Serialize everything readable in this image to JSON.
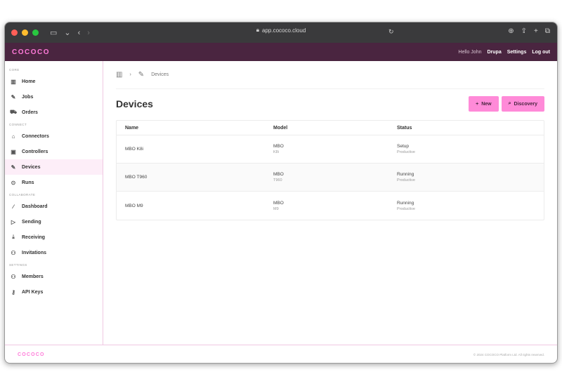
{
  "browser": {
    "url": "app.cococo.cloud"
  },
  "topbar": {
    "brand": "COCOCO",
    "greeting": "Hello John",
    "links": [
      "Drupa",
      "Settings",
      "Log out"
    ]
  },
  "sidebar": {
    "sections": [
      {
        "label": "CORE",
        "items": [
          {
            "label": "Home",
            "icon": "building-icon"
          },
          {
            "label": "Jobs",
            "icon": "wrench-icon"
          },
          {
            "label": "Orders",
            "icon": "cart-icon"
          }
        ]
      },
      {
        "label": "CONNECT",
        "items": [
          {
            "label": "Connectors",
            "icon": "plug-icon"
          },
          {
            "label": "Controllers",
            "icon": "chip-icon"
          },
          {
            "label": "Devices",
            "icon": "tool-icon",
            "active": true
          },
          {
            "label": "Runs",
            "icon": "play-icon"
          }
        ]
      },
      {
        "label": "COLLABORATE",
        "items": [
          {
            "label": "Dashboard",
            "icon": "pencil-icon"
          },
          {
            "label": "Sending",
            "icon": "send-icon"
          },
          {
            "label": "Receiving",
            "icon": "download-icon"
          },
          {
            "label": "Invitations",
            "icon": "users-icon"
          }
        ]
      },
      {
        "label": "SETTINGS",
        "items": [
          {
            "label": "Members",
            "icon": "users-icon"
          },
          {
            "label": "API Keys",
            "icon": "key-icon"
          }
        ]
      }
    ]
  },
  "breadcrumb": {
    "current": "Devices"
  },
  "page": {
    "title": "Devices",
    "new_label": "New",
    "discovery_label": "Discovery"
  },
  "table": {
    "headers": [
      "Name",
      "Model",
      "Status"
    ],
    "rows": [
      {
        "name": "MBO K8i",
        "model": "MBO",
        "model_sub": "K8i",
        "status": "Setup",
        "status_sub": "Productive"
      },
      {
        "name": "MBO T960",
        "model": "MBO",
        "model_sub": "T960",
        "status": "Running",
        "status_sub": "Productive"
      },
      {
        "name": "MBO M9",
        "model": "MBO",
        "model_sub": "M9",
        "status": "Running",
        "status_sub": "Productive"
      }
    ]
  },
  "footer": {
    "brand": "COCOCO",
    "copyright": "© 2024 COCOCO Platform Ltd. All rights reserved."
  },
  "colors": {
    "accent": "#ff8ad8",
    "topbar": "#4a2540",
    "brand": "#ff7ad9"
  }
}
